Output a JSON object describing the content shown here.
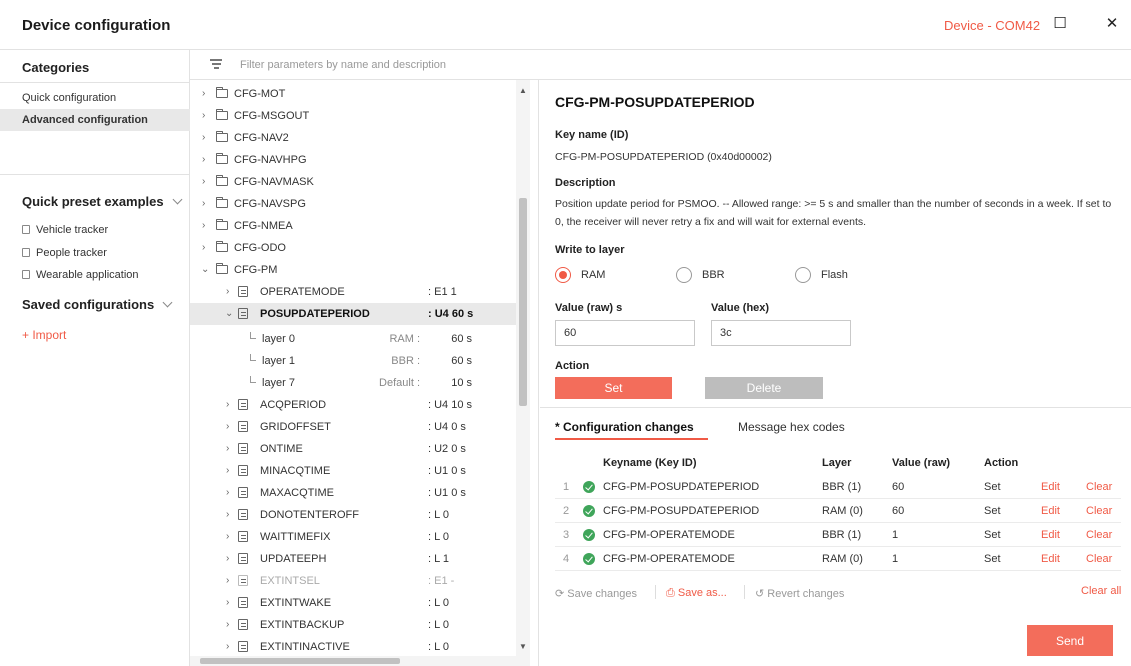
{
  "window": {
    "title": "Device configuration",
    "device": "Device - COM42",
    "maximize_glyph": "☐",
    "close_glyph": "✕"
  },
  "sidebar": {
    "categories_title": "Categories",
    "categories": [
      {
        "label": "Quick configuration",
        "active": false
      },
      {
        "label": "Advanced configuration",
        "active": true
      }
    ],
    "presets_title": "Quick preset examples",
    "presets": [
      "Vehicle tracker",
      "People tracker",
      "Wearable application"
    ],
    "saved_title": "Saved configurations",
    "import_label": "+ Import"
  },
  "filter": {
    "placeholder": "Filter parameters by name and description",
    "value": ""
  },
  "tree": {
    "folders": [
      "CFG-MOT",
      "CFG-MSGOUT",
      "CFG-NAV2",
      "CFG-NAVHPG",
      "CFG-NAVMASK",
      "CFG-NAVSPG",
      "CFG-NMEA",
      "CFG-ODO",
      "CFG-PM"
    ],
    "pm_params": [
      {
        "name": "OPERATEMODE",
        "type": ": E1  1"
      },
      {
        "name": "POSUPDATEPERIOD",
        "type": ": U4  60 s"
      },
      {
        "name": "ACQPERIOD",
        "type": ": U4  10 s"
      },
      {
        "name": "GRIDOFFSET",
        "type": ": U4  0 s"
      },
      {
        "name": "ONTIME",
        "type": ": U2  0 s"
      },
      {
        "name": "MINACQTIME",
        "type": ": U1  0 s"
      },
      {
        "name": "MAXACQTIME",
        "type": ": U1  0 s"
      },
      {
        "name": "DONOTENTEROFF",
        "type": ": L   0"
      },
      {
        "name": "WAITTIMEFIX",
        "type": ": L   0"
      },
      {
        "name": "UPDATEEPH",
        "type": ": L   1"
      },
      {
        "name": "EXTINTSEL",
        "type": ": E1  -"
      },
      {
        "name": "EXTINTWAKE",
        "type": ": L   0"
      },
      {
        "name": "EXTINTBACKUP",
        "type": ": L   0"
      },
      {
        "name": "EXTINTINACTIVE",
        "type": ": L   0"
      }
    ],
    "layers": [
      {
        "name": "layer 0",
        "kind": "RAM :",
        "value": "60 s"
      },
      {
        "name": "layer 1",
        "kind": "BBR :",
        "value": "60 s"
      },
      {
        "name": "layer 7",
        "kind": "Default :",
        "value": "10 s"
      }
    ]
  },
  "detail": {
    "title": "CFG-PM-POSUPDATEPERIOD",
    "key_label": "Key name (ID)",
    "key_value": "CFG-PM-POSUPDATEPERIOD (0x40d00002)",
    "desc_label": "Description",
    "desc_text": "Position update period for PSMOO. -- Allowed range: >= 5 s and smaller than the number of seconds in a week. If set to 0, the receiver will never retry a fix and will wait for external events.",
    "layer_label": "Write to layer",
    "layers": [
      "RAM",
      "BBR",
      "Flash"
    ],
    "selected_layer": "RAM",
    "raw_label": "Value (raw) s",
    "raw_value": "60",
    "hex_label": "Value (hex)",
    "hex_value": "3c",
    "action_label": "Action",
    "set_label": "Set",
    "delete_label": "Delete"
  },
  "changes": {
    "tabs": [
      "* Configuration changes",
      "Message hex codes"
    ],
    "headers": [
      "Keyname (Key ID)",
      "Layer",
      "Value (raw)",
      "Action"
    ],
    "rows": [
      {
        "idx": "1",
        "key": "CFG-PM-POSUPDATEPERIOD",
        "layer": "BBR (1)",
        "value": "60",
        "action": "Set"
      },
      {
        "idx": "2",
        "key": "CFG-PM-POSUPDATEPERIOD",
        "layer": "RAM (0)",
        "value": "60",
        "action": "Set"
      },
      {
        "idx": "3",
        "key": "CFG-PM-OPERATEMODE",
        "layer": "BBR (1)",
        "value": "1",
        "action": "Set"
      },
      {
        "idx": "4",
        "key": "CFG-PM-OPERATEMODE",
        "layer": "RAM (0)",
        "value": "1",
        "action": "Set"
      }
    ],
    "edit_label": "Edit",
    "clear_label": "Clear",
    "save_changes": "Save changes",
    "save_as": "Save as...",
    "revert": "Revert changes",
    "clear_all": "Clear all",
    "send": "Send"
  },
  "colors": {
    "accent": "#f05a46",
    "success": "#3fa55a",
    "disabled": "#bdbdbd"
  }
}
